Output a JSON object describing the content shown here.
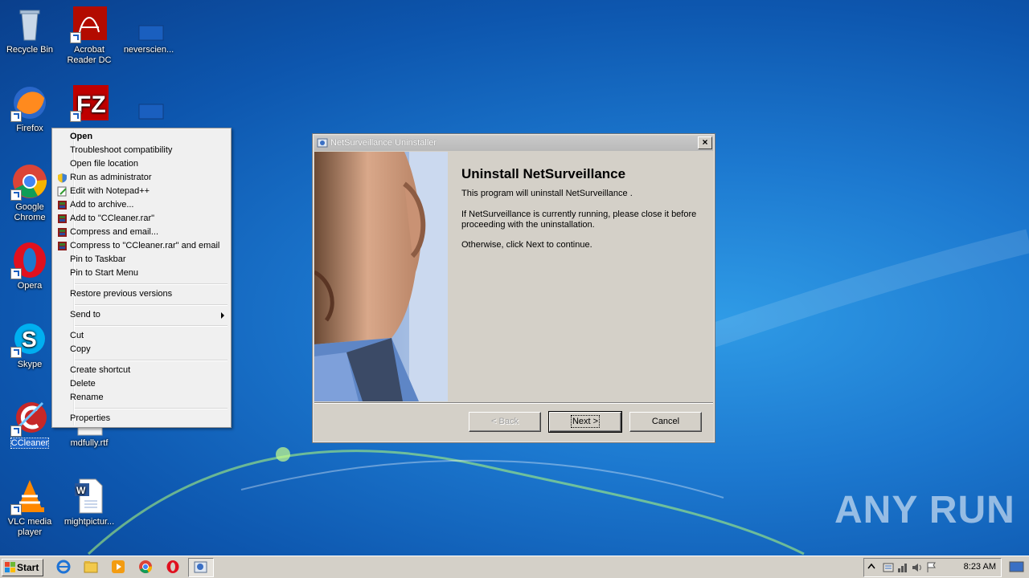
{
  "desktop": {
    "icons": [
      {
        "label": "Recycle Bin"
      },
      {
        "label": "Acrobat Reader DC"
      },
      {
        "label": "neverscien..."
      },
      {
        "label": "Firefox"
      },
      {
        "label": "Google Chrome"
      },
      {
        "label": "Opera"
      },
      {
        "label": "Skype"
      },
      {
        "label": "CCleaner"
      },
      {
        "label": "mdfully.rtf"
      },
      {
        "label": "VLC media player"
      },
      {
        "label": "mightpictur..."
      }
    ],
    "watermark": "ANY RUN"
  },
  "context_menu": {
    "items": [
      {
        "label": "Open"
      },
      {
        "label": "Troubleshoot compatibility"
      },
      {
        "label": "Open file location"
      },
      {
        "label": "Run as administrator"
      },
      {
        "label": "Edit with Notepad++"
      },
      {
        "label": "Add to archive..."
      },
      {
        "label": "Add to \"CCleaner.rar\""
      },
      {
        "label": "Compress and email..."
      },
      {
        "label": "Compress to \"CCleaner.rar\" and email"
      },
      {
        "label": "Pin to Taskbar"
      },
      {
        "label": "Pin to Start Menu"
      },
      {
        "label": "Restore previous versions"
      },
      {
        "label": "Send to"
      },
      {
        "label": "Cut"
      },
      {
        "label": "Copy"
      },
      {
        "label": "Create shortcut"
      },
      {
        "label": "Delete"
      },
      {
        "label": "Rename"
      },
      {
        "label": "Properties"
      }
    ]
  },
  "dialog": {
    "title": "NetSurveillance Uninstaller",
    "close": "×",
    "heading": "Uninstall NetSurveillance",
    "p1": "This program will uninstall NetSurveillance .",
    "p2": "If NetSurveillance is currently running, please close it before proceeding with the uninstallation.",
    "p3": "Otherwise, click Next to continue.",
    "back": "< Back",
    "next": "Next >",
    "cancel": "Cancel"
  },
  "taskbar": {
    "start": "Start",
    "clock": "8:23 AM"
  }
}
